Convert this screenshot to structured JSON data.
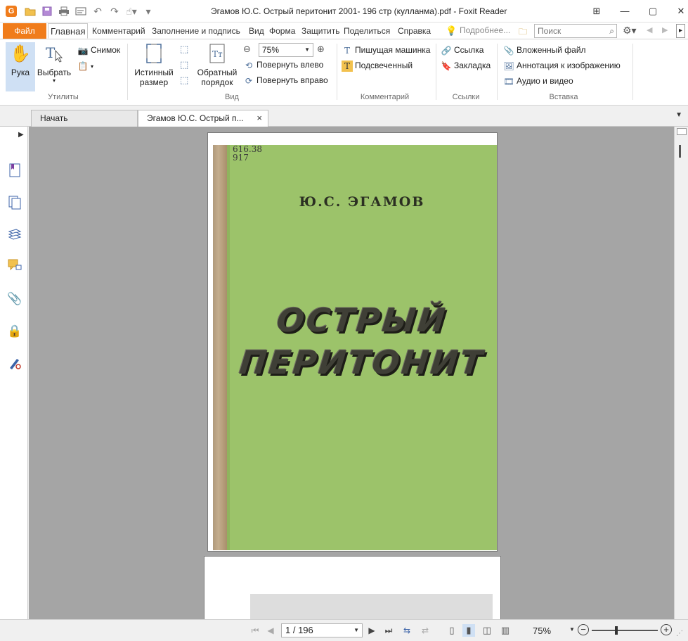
{
  "window": {
    "title": "Эгамов Ю.С. Острый перитонит 2001- 196 стр (кулланма).pdf - Foxit Reader",
    "app_logo": "G",
    "controls": [
      "restore-grid-icon",
      "minimize-icon",
      "maximize-icon",
      "close-icon"
    ]
  },
  "menu": {
    "file": "Файл",
    "tabs": [
      "Главная",
      "Комментарий",
      "Заполнение и подпись",
      "Вид",
      "Форма",
      "Защитить",
      "Поделиться",
      "Справка"
    ],
    "active_tab": "Главная",
    "hint": "Подробнее...",
    "search_placeholder": "Поиск"
  },
  "ribbon": {
    "utilities": {
      "hand": "Рука",
      "select": "Выбрать",
      "snapshot": "Снимок",
      "label": "Утилиты"
    },
    "view": {
      "actual_size": [
        "Истинный",
        "размер"
      ],
      "reverse": [
        "Обратный",
        "порядок"
      ],
      "zoom_value": "75%",
      "rotate_left": "Повернуть влево",
      "rotate_right": "Повернуть вправо",
      "label": "Вид"
    },
    "comment": {
      "typewriter": "Пишущая машинка",
      "highlight": "Подсвеченный",
      "label": "Комментарий"
    },
    "links": {
      "link": "Ссылка",
      "bookmark": "Закладка",
      "label": "Ссылки"
    },
    "insert": {
      "attachment": "Вложенный файл",
      "image_annotation": "Аннотация к изображению",
      "audio_video": "Аудио и видео",
      "label": "Вставка"
    }
  },
  "doc_tabs": {
    "start": "Начать",
    "active": "Эгамов Ю.С. Острый п...",
    "close": "×"
  },
  "cover": {
    "handwritten": [
      "616.38",
      "917"
    ],
    "author": "Ю.С. ЭГАМОВ",
    "title_line1": "ОСТРЫЙ",
    "title_line2": "ПЕРИТОНИТ"
  },
  "status": {
    "page": "1 / 196",
    "zoom": "75%",
    "zoom_level_fraction": 0.35
  }
}
